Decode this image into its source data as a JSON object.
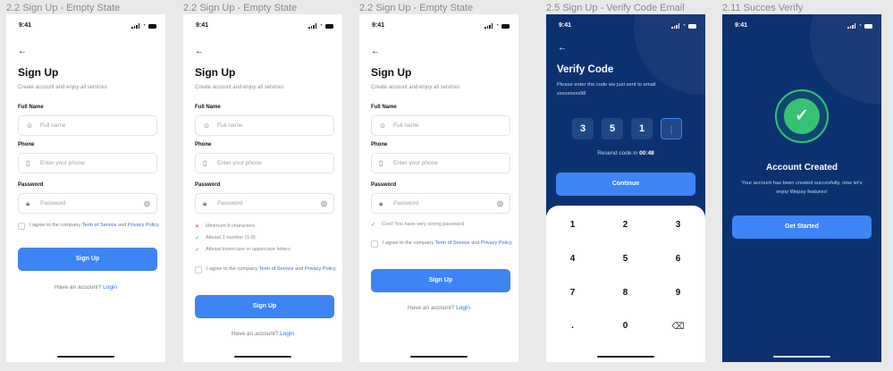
{
  "status": {
    "time": "9:41"
  },
  "frames": [
    {
      "label": "2.2 Sign Up - Empty State",
      "title": "Sign Up",
      "subtitle": "Create account and enjoy all services",
      "fields": {
        "full_name": {
          "label": "Full Name",
          "placeholder": "Full name",
          "icon": "user-icon"
        },
        "phone": {
          "label": "Phone",
          "placeholder": "Enter your phone",
          "icon": "phone-icon"
        },
        "password": {
          "label": "Password",
          "placeholder": "Password",
          "icon": "lock-icon",
          "toggle_icon": "eye-off-icon"
        }
      },
      "terms": {
        "prefix": "I agree to the company ",
        "link1": "Term of Service",
        "middle": " and ",
        "link2": "Privacy Policy"
      },
      "button": "Sign Up",
      "footer": {
        "text": "Have an account? ",
        "link": "Login"
      }
    },
    {
      "label": "2.2 Sign Up - Empty State",
      "title": "Sign Up",
      "subtitle": "Create account and enjoy all services",
      "fields": {
        "full_name": {
          "label": "Full Name",
          "placeholder": "Full name"
        },
        "phone": {
          "label": "Phone",
          "placeholder": "Enter your phone"
        },
        "password": {
          "label": "Password",
          "placeholder": "Password"
        }
      },
      "hints": [
        {
          "text": "Minimum 8 characters",
          "state": "invalid"
        },
        {
          "text": "Atleast 1 number (1-9)",
          "state": "valid"
        },
        {
          "text": "Atleast lowercase or uppercase letters",
          "state": "valid"
        }
      ],
      "terms": {
        "prefix": "I agree to the company ",
        "link1": "Term of Service",
        "middle": " and ",
        "link2": "Privacy Policy"
      },
      "button": "Sign Up",
      "footer": {
        "text": "Have an account? ",
        "link": "Login"
      }
    },
    {
      "label": "2.2 Sign Up - Empty State",
      "title": "Sign Up",
      "subtitle": "Create account and enjoy all services",
      "fields": {
        "full_name": {
          "label": "Full Name",
          "placeholder": "Full name"
        },
        "phone": {
          "label": "Phone",
          "placeholder": "Enter your phone"
        },
        "password": {
          "label": "Password",
          "placeholder": "Password"
        }
      },
      "hints": [
        {
          "text": "Cool! You have very strong password",
          "state": "valid"
        }
      ],
      "terms": {
        "prefix": "I agree to the company ",
        "link1": "Term of Service",
        "middle": " and ",
        "link2": "Privacy Policy"
      },
      "button": "Sign Up",
      "footer": {
        "text": "Have an account? ",
        "link": "Login"
      }
    },
    {
      "label": "2.5 Sign Up - Verify Code Email",
      "title": "Verify Code",
      "subtitle": "Please enter the code we just sent to email",
      "email": "xxxxxxxxx98",
      "code_digits": [
        "3",
        "5",
        "1",
        "|"
      ],
      "resend": {
        "text": "Resend code in ",
        "countdown": "00:48"
      },
      "button": "Continue",
      "keypad": [
        "1",
        "2",
        "3",
        "4",
        "5",
        "6",
        "7",
        "8",
        "9",
        ".",
        "0"
      ],
      "backspace_icon": "backspace-icon"
    },
    {
      "label": "2.11 Succes Verify",
      "title": "Account Created",
      "subtitle": "Your account has been created succesfully, now let's enjoy Wepay features!",
      "success_icon": "check-circle-icon",
      "button": "Get Started"
    }
  ],
  "colors": {
    "primary": "#3d84f5",
    "dark_bg": "#0c3170",
    "success": "#35c373",
    "error": "#e0443c",
    "link": "#2e6fd9"
  }
}
